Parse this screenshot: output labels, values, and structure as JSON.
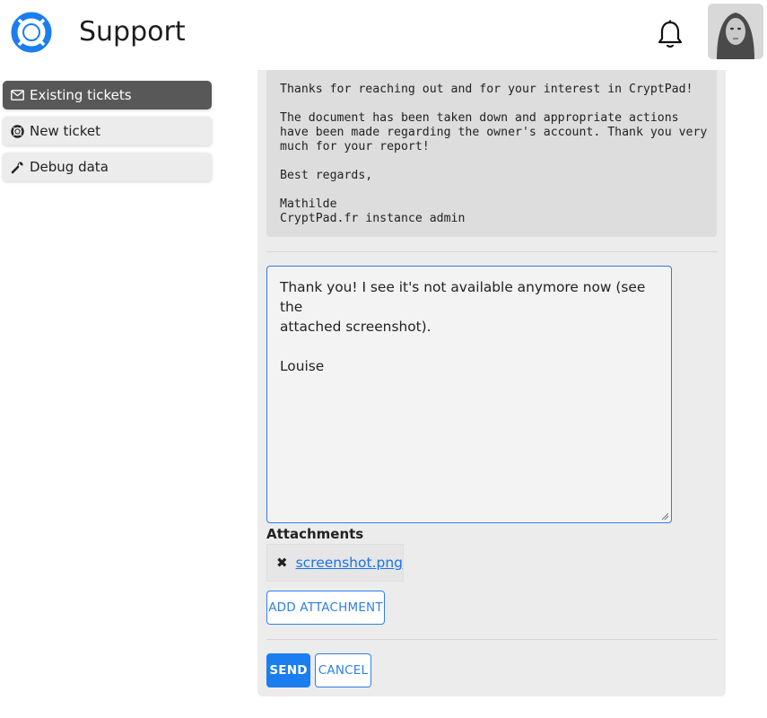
{
  "header": {
    "title": "Support",
    "logo_icon": "lifebuoy-icon",
    "notification_icon": "bell-icon",
    "accent_color": "#1a7df0"
  },
  "sidebar": {
    "items": [
      {
        "label": "Existing tickets",
        "icon": "envelope-icon",
        "active": true
      },
      {
        "label": "New ticket",
        "icon": "lifebuoy-icon",
        "active": false
      },
      {
        "label": "Debug data",
        "icon": "wrench-icon",
        "active": false
      }
    ]
  },
  "ticket": {
    "message_lines": [
      "Thanks for reaching out and for your interest in CryptPad!",
      "",
      "The document has been taken down and appropriate actions",
      "have been made regarding the owner's account. Thank you very",
      "much for your report!",
      "",
      "Best regards,",
      "",
      "Mathilde",
      "CryptPad.fr instance admin"
    ]
  },
  "reply": {
    "line1": "Thank you! I see it's not available anymore now (see the",
    "line2": "attached screenshot).",
    "line3": "Louise"
  },
  "attachments": {
    "title": "Attachments",
    "remove_icon": "close-icon",
    "files": [
      "screenshot.png"
    ],
    "add_label": "ADD ATTACHMENT"
  },
  "actions": {
    "send_label": "SEND",
    "cancel_label": "CANCEL"
  }
}
